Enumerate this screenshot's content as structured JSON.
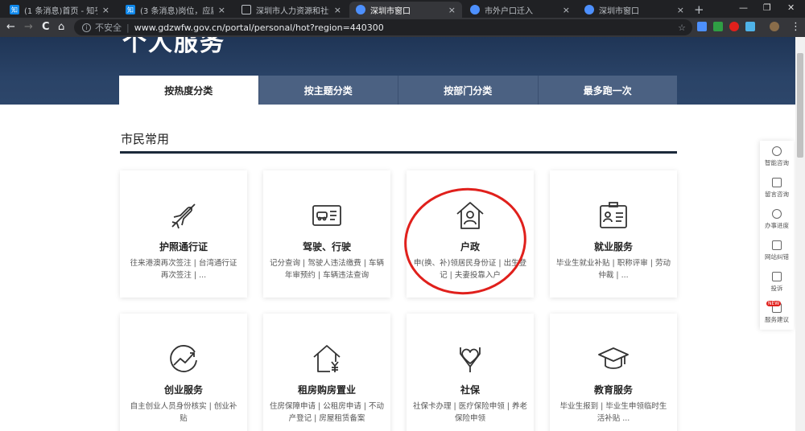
{
  "browser": {
    "tabs": [
      {
        "favicon": "zhihu-icon",
        "fav_text": "知",
        "title": "(1 条消息)首页 - 知乎"
      },
      {
        "favicon": "zhihu-icon",
        "fav_text": "知",
        "title": "(3 条消息)岗位，应届生怎么..."
      },
      {
        "favicon": "document-icon",
        "fav_text": "",
        "title": "深圳市人力资源和社会保障局"
      },
      {
        "favicon": "shenzhen-gov-icon",
        "fav_text": "",
        "title": "深圳市窗口"
      },
      {
        "favicon": "shenzhen-gov-icon",
        "fav_text": "",
        "title": "市外户口迁入"
      },
      {
        "favicon": "shenzhen-gov-icon",
        "fav_text": "",
        "title": "深圳市窗口"
      }
    ],
    "new_tab": "+",
    "window_controls": {
      "minimize": "—",
      "maximize": "❐",
      "close": "✕"
    },
    "nav": {
      "back": "←",
      "forward": "→",
      "reload": "C",
      "home": "⌂"
    },
    "omnibox": {
      "security": "不安全",
      "url": "www.gdzwfw.gov.cn/portal/personal/hot?region=440300"
    },
    "menu": "⋮"
  },
  "banner": {
    "title": "个人服务"
  },
  "category_tabs": [
    "按热度分类",
    "按主题分类",
    "按部门分类",
    "最多跑一次"
  ],
  "section": {
    "title": "市民常用"
  },
  "cards": [
    {
      "icon": "airplane-icon",
      "name": "护照通行证",
      "desc": "往来港澳再次签注 | 台湾通行证再次签注 | ..."
    },
    {
      "icon": "driver-license-icon",
      "name": "驾驶、行驶",
      "desc": "记分查询 | 驾驶人违法缴费 | 车辆年审预约 | 车辆违法查询"
    },
    {
      "icon": "house-person-icon",
      "name": "户政",
      "desc": "申(换、补)领居民身份证 | 出生登记 | 夫妻投靠入户"
    },
    {
      "icon": "employment-badge-icon",
      "name": "就业服务",
      "desc": "毕业生就业补贴 | 职称评审 | 劳动仲裁 | ..."
    },
    {
      "icon": "growth-chart-icon",
      "name": "创业服务",
      "desc": "自主创业人员身份核实 | 创业补贴"
    },
    {
      "icon": "house-yuan-icon",
      "name": "租房购房置业",
      "desc": "住房保障申请 | 公租房申请 | 不动产登记 | 房屋租赁备案"
    },
    {
      "icon": "heart-hands-icon",
      "name": "社保",
      "desc": "社保卡办理 | 医疗保险申领 | 养老保险申领"
    },
    {
      "icon": "graduation-cap-icon",
      "name": "教育服务",
      "desc": "毕业生报到 | 毕业生申领临时生活补贴 ..."
    }
  ],
  "side_panel": {
    "items": [
      {
        "icon": "headset-icon",
        "label": "智能咨询"
      },
      {
        "icon": "message-icon",
        "label": "留言咨询"
      },
      {
        "icon": "progress-icon",
        "label": "办事进度"
      },
      {
        "icon": "correction-icon",
        "label": "网站纠错"
      },
      {
        "icon": "complaint-icon",
        "label": "投诉"
      },
      {
        "icon": "suggestion-icon",
        "label": "服务建议",
        "badge": "NEW"
      }
    ]
  },
  "colors": {
    "banner": "#2a4367",
    "tab_inactive": "#4b6182",
    "annotation": "#e0201c"
  }
}
